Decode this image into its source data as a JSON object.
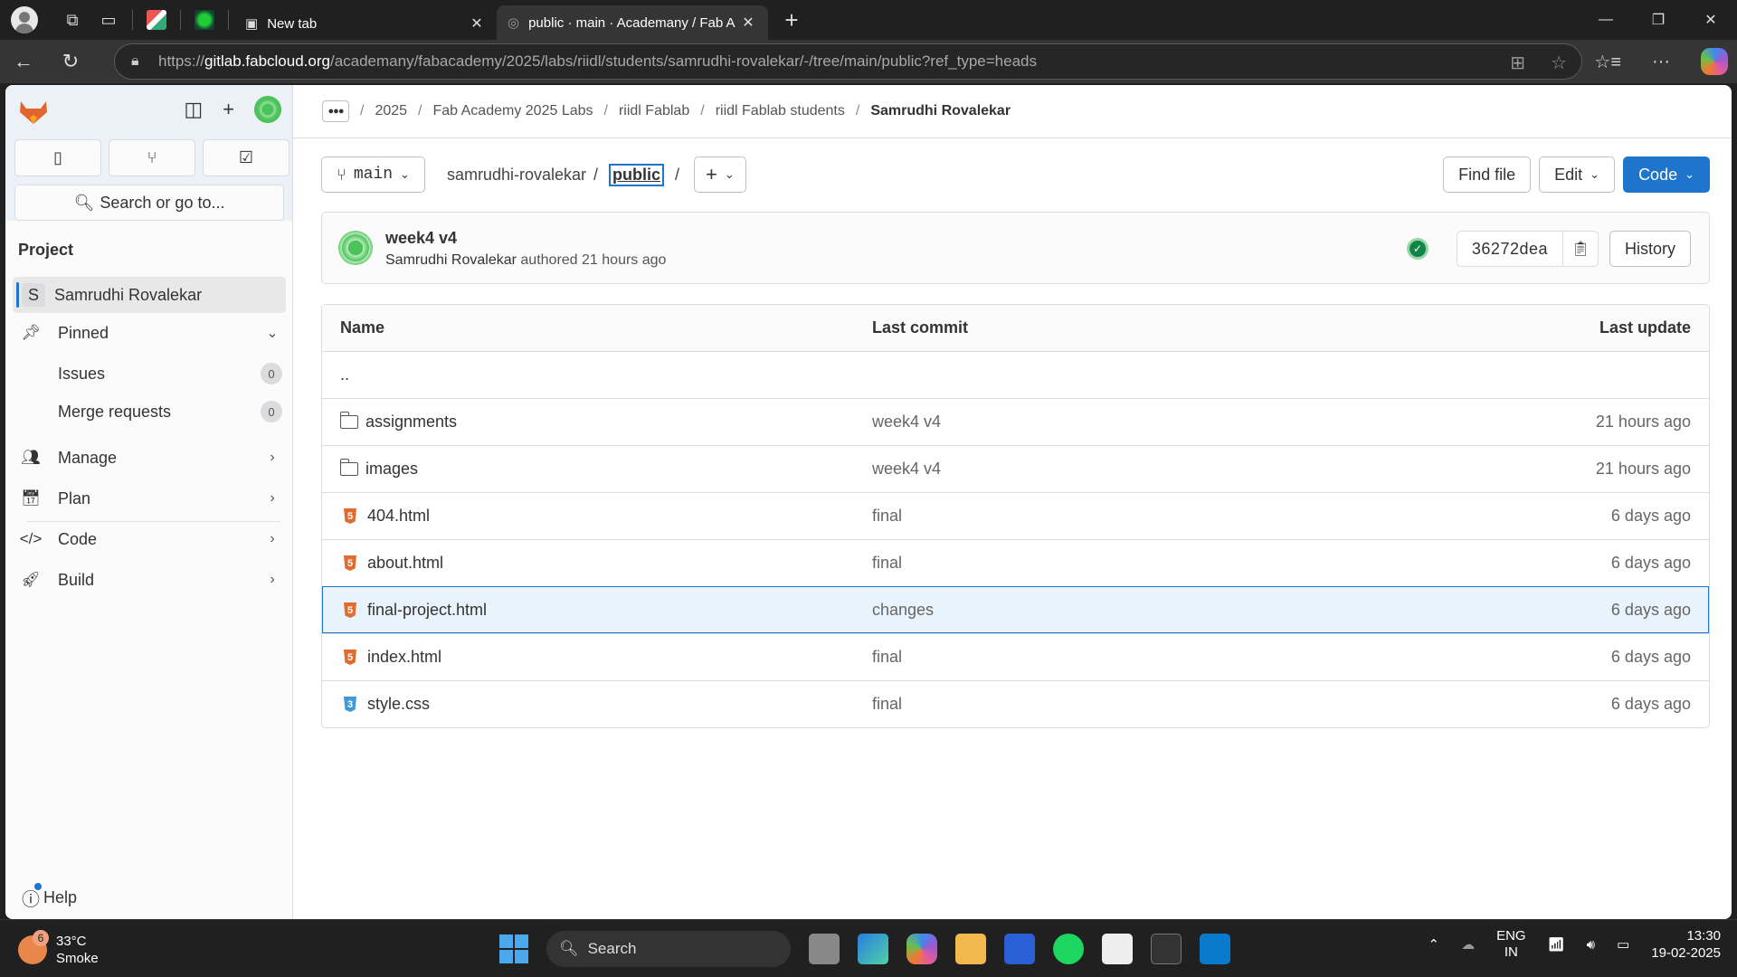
{
  "browser": {
    "tabs": [
      {
        "label": "New tab",
        "active": false
      },
      {
        "label": "public · main · Academany / Fab A",
        "active": true
      }
    ],
    "url": {
      "protocol": "https://",
      "host": "gitlab.fabcloud.org",
      "path": "/academany/fabacademy/2025/labs/riidl/students/samrudhi-rovalekar/-/tree/main/public?ref_type=heads"
    }
  },
  "sidebar": {
    "search_label": "Search or go to...",
    "section_heading": "Project",
    "project_chip": "S",
    "project_name": "Samrudhi Rovalekar",
    "pinned_label": "Pinned",
    "pinned_items": [
      {
        "label": "Issues",
        "count": "0"
      },
      {
        "label": "Merge requests",
        "count": "0"
      }
    ],
    "nav_items": [
      {
        "label": "Manage"
      },
      {
        "label": "Plan"
      },
      {
        "label": "Code"
      },
      {
        "label": "Build"
      }
    ],
    "help_label": "Help"
  },
  "breadcrumb": {
    "items": [
      "2025",
      "Fab Academy 2025 Labs",
      "riidl Fablab",
      "riidl Fablab students"
    ],
    "current": "Samrudhi Rovalekar"
  },
  "repo": {
    "branch": "main",
    "path_root": "samrudhi-rovalekar",
    "path_current": "public",
    "find_file_label": "Find file",
    "edit_label": "Edit",
    "code_label": "Code",
    "plus_label": "+"
  },
  "commit": {
    "title": "week4 v4",
    "author": "Samrudhi Rovalekar",
    "action": "authored",
    "time": "21 hours ago",
    "sha": "36272dea",
    "history_label": "History"
  },
  "table": {
    "headers": {
      "name": "Name",
      "commit": "Last commit",
      "date": "Last update"
    },
    "parent": "..",
    "rows": [
      {
        "type": "folder",
        "name": "assignments",
        "commit": "week4 v4",
        "date": "21 hours ago"
      },
      {
        "type": "folder",
        "name": "images",
        "commit": "week4 v4",
        "date": "21 hours ago"
      },
      {
        "type": "html",
        "name": "404.html",
        "commit": "final",
        "date": "6 days ago"
      },
      {
        "type": "html",
        "name": "about.html",
        "commit": "final",
        "date": "6 days ago"
      },
      {
        "type": "html",
        "name": "final-project.html",
        "commit": "changes",
        "date": "6 days ago",
        "selected": true
      },
      {
        "type": "html",
        "name": "index.html",
        "commit": "final",
        "date": "6 days ago"
      },
      {
        "type": "css",
        "name": "style.css",
        "commit": "final",
        "date": "6 days ago"
      }
    ]
  },
  "taskbar": {
    "weather_temp": "33°C",
    "weather_desc": "Smoke",
    "weather_badge": "6",
    "search_label": "Search",
    "lang_top": "ENG",
    "lang_bottom": "IN",
    "time": "13:30",
    "date": "19-02-2025"
  },
  "colors": {
    "accent": "#1f75cb",
    "gitlab_orange": "#e24329",
    "html_icon": "#e06c2f",
    "css_icon": "#3e9ad6",
    "success": "#108548"
  }
}
